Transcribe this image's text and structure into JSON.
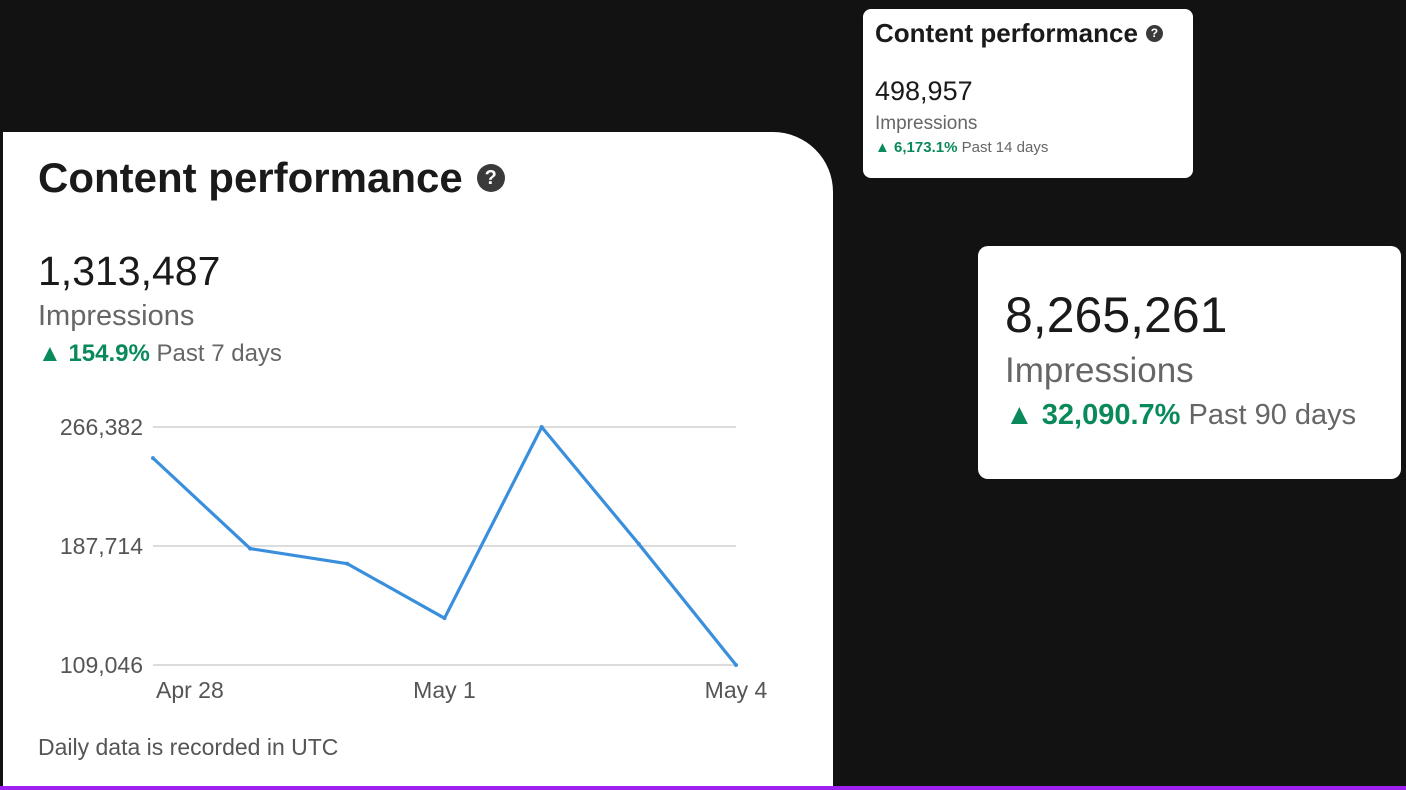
{
  "main_card": {
    "title": "Content performance",
    "help_glyph": "?",
    "value": "1,313,487",
    "metric": "Impressions",
    "arrow": "▲",
    "change_pct": "154.9%",
    "period": "Past 7 days",
    "footnote": "Daily data is recorded in UTC"
  },
  "small_card": {
    "title": "Content performance",
    "help_glyph": "?",
    "value": "498,957",
    "metric": "Impressions",
    "arrow": "▲",
    "change_pct": "6,173.1%",
    "period": "Past 14 days"
  },
  "right_card": {
    "value": "8,265,261",
    "metric": "Impressions",
    "arrow": "▲",
    "change_pct": "32,090.7%",
    "period": "Past 90 days"
  },
  "colors": {
    "background": "#121212",
    "line": "#3a8fdd",
    "positive": "#0a8a5a",
    "bottom_strip": "#a020f0"
  },
  "chart_data": {
    "type": "line",
    "x": [
      "Apr 28",
      "Apr 29",
      "Apr 30",
      "May 1",
      "May 2",
      "May 3",
      "May 4"
    ],
    "x_tick_labels": [
      "Apr 28",
      "May 1",
      "May 4"
    ],
    "series": [
      {
        "values": [
          245800,
          186000,
          176000,
          140000,
          266382,
          189000,
          109046
        ]
      }
    ],
    "y_tick_labels": [
      "266,382",
      "187,714",
      "109,046"
    ],
    "ylim": [
      109046,
      266382
    ],
    "grid": true,
    "legend": "none"
  }
}
